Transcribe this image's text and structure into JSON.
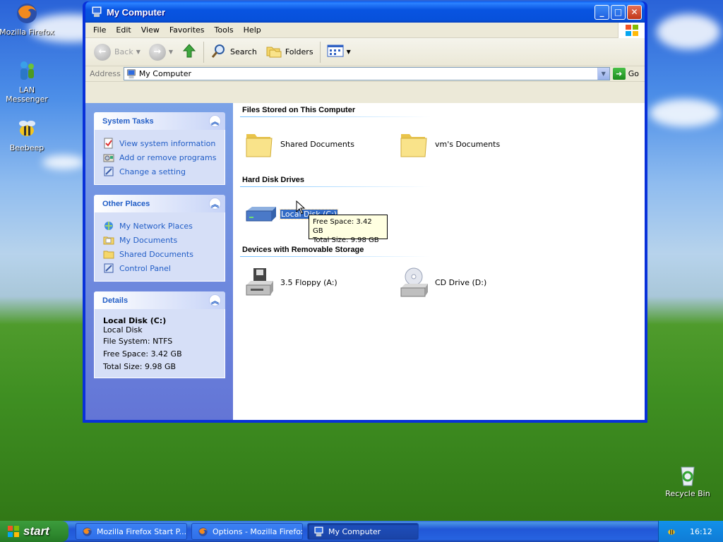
{
  "desktop": {
    "icons": [
      {
        "label": "Mozilla Firefox",
        "icon": "firefox-icon"
      },
      {
        "label": "LAN Messenger",
        "icon": "lan-messenger-icon"
      },
      {
        "label": "Beebeep",
        "icon": "beebeep-icon"
      },
      {
        "label": "Recycle Bin",
        "icon": "recycle-bin-icon"
      }
    ]
  },
  "window": {
    "title": "My Computer",
    "menu": [
      "File",
      "Edit",
      "View",
      "Favorites",
      "Tools",
      "Help"
    ],
    "toolbar": {
      "back": "Back",
      "search": "Search",
      "folders": "Folders"
    },
    "address": {
      "label": "Address",
      "value": "My Computer",
      "go": "Go"
    }
  },
  "sidebar": {
    "system_tasks": {
      "title": "System Tasks",
      "items": [
        "View system information",
        "Add or remove programs",
        "Change a setting"
      ]
    },
    "other_places": {
      "title": "Other Places",
      "items": [
        "My Network Places",
        "My Documents",
        "Shared Documents",
        "Control Panel"
      ]
    },
    "details": {
      "title": "Details",
      "name": "Local Disk (C:)",
      "type": "Local Disk",
      "file_system": "File System: NTFS",
      "free_space": "Free Space: 3.42 GB",
      "total_size": "Total Size: 9.98 GB"
    }
  },
  "content": {
    "files_header": "Files Stored on This Computer",
    "files": [
      "Shared Documents",
      "vm's Documents"
    ],
    "hdd_header": "Hard Disk Drives",
    "hdd": [
      "Local Disk (C:)"
    ],
    "removable_header": "Devices with Removable Storage",
    "removable": [
      "3.5 Floppy (A:)",
      "CD Drive (D:)"
    ],
    "tooltip": {
      "free": "Free Space: 3.42 GB",
      "total": "Total Size: 9.98 GB"
    }
  },
  "taskbar": {
    "start": "start",
    "tasks": [
      "Mozilla Firefox Start P...",
      "Options - Mozilla Firefox",
      "My Computer"
    ],
    "clock": "16:12"
  },
  "colors": {
    "link": "#215dc6",
    "selection": "#316ac5",
    "title_blue": "#0a5ff4"
  }
}
